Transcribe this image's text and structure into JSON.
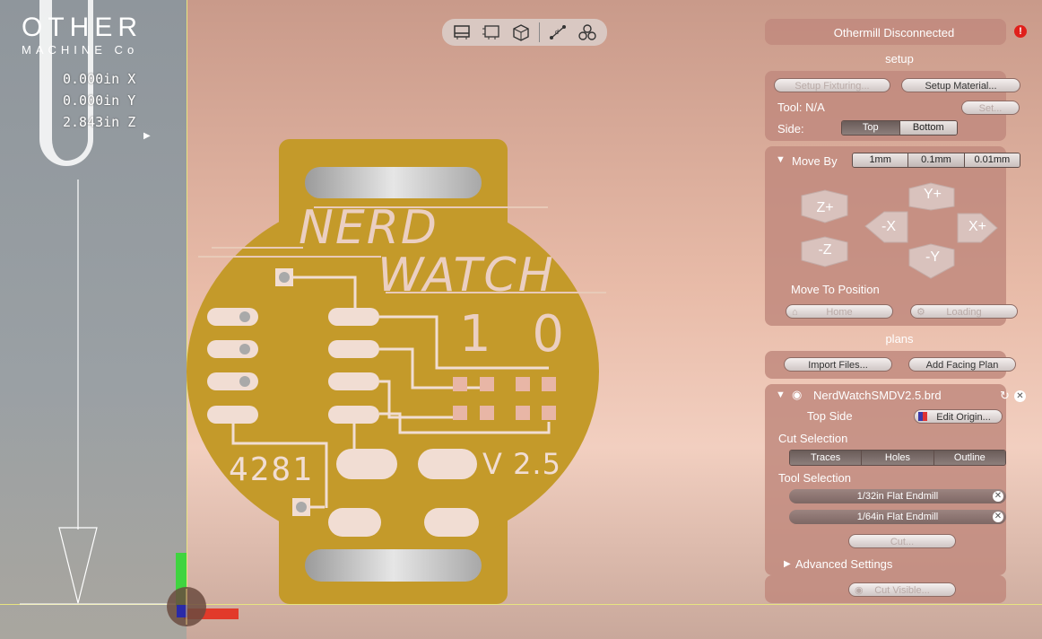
{
  "logo": {
    "line1": "OTHER",
    "line2": "MACHINE Co"
  },
  "coords": {
    "x": "0.000in X",
    "y": "0.000in Y",
    "z": "2.843in Z"
  },
  "toolbar": {
    "icons": [
      "board-top-icon",
      "board-frame-icon",
      "cube-3d-icon",
      "measure-icon",
      "circles-icon"
    ]
  },
  "board": {
    "title1": "NERD",
    "title2": "WATCH",
    "digits": "1 0",
    "number": "4281",
    "version": "V 2.5"
  },
  "status": {
    "text": "Othermill Disconnected",
    "icon": "alert-icon"
  },
  "setup": {
    "title": "setup",
    "fixturing_label": "Setup Fixturing...",
    "material_label": "Setup Material...",
    "tool_label": "Tool: N/A",
    "set_label": "Set...",
    "side_label": "Side:",
    "side_options": [
      "Top",
      "Bottom"
    ],
    "side_selected": "Top"
  },
  "move": {
    "title": "Move By",
    "options": [
      "1mm",
      "0.1mm",
      "0.01mm"
    ],
    "selected": "0.1mm",
    "jog": {
      "zplus": "Z+",
      "zminus": "-Z",
      "yplus": "Y+",
      "yminus": "-Y",
      "xminus": "-X",
      "xplus": "X+"
    },
    "position_label": "Move To Position",
    "home_label": "Home",
    "loading_label": "Loading"
  },
  "plans": {
    "title": "plans",
    "import_label": "Import Files...",
    "facing_label": "Add Facing Plan",
    "file_name": "NerdWatchSMDV2.5.brd",
    "side_text": "Top Side",
    "edit_origin_label": "Edit Origin...",
    "cut_selection_label": "Cut Selection",
    "cut_options": [
      "Traces",
      "Holes",
      "Outline"
    ],
    "cut_selected": "Traces",
    "tool_selection_label": "Tool Selection",
    "tools": [
      "1/32in Flat Endmill",
      "1/64in Flat Endmill"
    ],
    "cut_label": "Cut...",
    "advanced_label": "Advanced Settings",
    "cut_visible_label": "Cut Visible..."
  }
}
